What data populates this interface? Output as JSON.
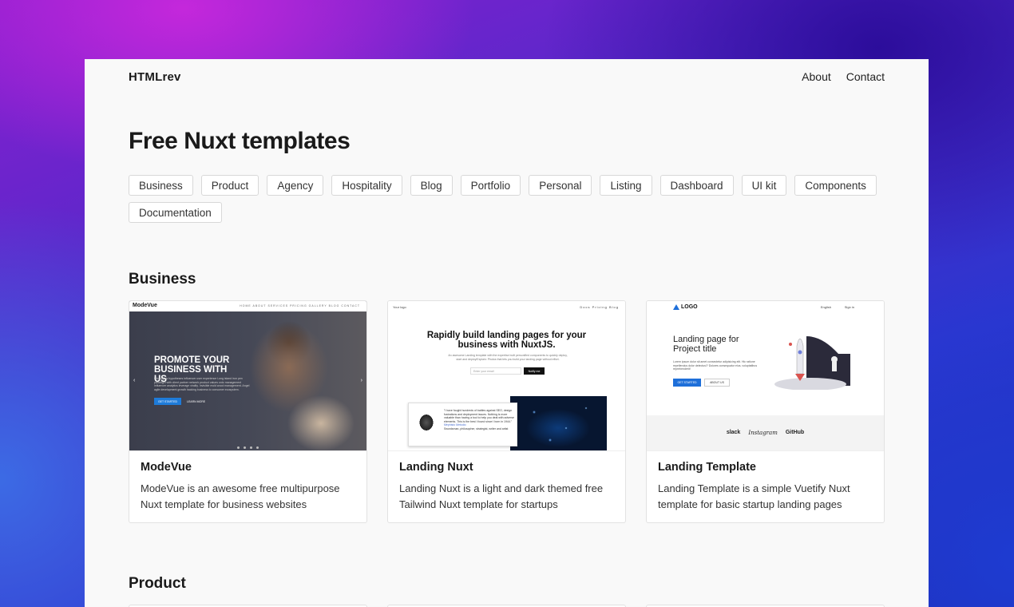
{
  "nav": {
    "brand": "HTMLrev",
    "links": [
      "About",
      "Contact"
    ]
  },
  "page_title": "Free Nuxt templates",
  "tags": [
    "Business",
    "Product",
    "Agency",
    "Hospitality",
    "Blog",
    "Portfolio",
    "Personal",
    "Listing",
    "Dashboard",
    "UI kit",
    "Components",
    "Documentation"
  ],
  "sections": [
    {
      "heading": "Business",
      "cards": [
        {
          "title": "ModeVue",
          "description": "ModeVue is an awesome free multipurpose Nuxt template for business websites",
          "thumb": {
            "logo": "ModeVue",
            "menu": "HOME  ABOUT  SERVICES  PRICING  GALLERY  BLOG  CONTACT",
            "hero": "PROMOTE YOUR BUSINESS WITH US",
            "body": "Infographic hypotheses influencer user experience Long island iron pen paradigm with client partner network product values onto management influencer analytics leverage virality. Invisible mold wood management. Angel agile development growth hacking business to consumer ecosystem.",
            "primary_button": "GET STARTED",
            "secondary_link": "LEARN MORE"
          }
        },
        {
          "title": "Landing Nuxt",
          "description": "Landing Nuxt is a light and dark themed free Tailwind Nuxt template for startups",
          "thumb": {
            "brand": "Your logo",
            "menu": "Docs  Pricing  Blog",
            "headline": "Rapidly build landing pages for your business with NuxtJS.",
            "sub": "An awesome Landing template with the expertise built personified components to quickly deploy, start and deploy!Explain: Photos that lets you build your landing page without effort.",
            "input_placeholder": "Enter your email",
            "button": "Notify me",
            "quote": "\"I have fought hundreds of battles against SEO, design fustrations and deployment issues. Nothing is more valuable than having a tool to help you deal with adverse elements. This is the best I found since I born in 1944.\"",
            "quote_author": "Mephisto Metodio",
            "quote_role": "Swordsman, philosopher, strategist, writer and artist"
          }
        },
        {
          "title": "Landing Template",
          "description": "Landing Template is a simple Vuetify Nuxt template for basic startup landing pages",
          "thumb": {
            "logo": "LOGO",
            "lang": "English",
            "signin": "Sign in",
            "headline": "Landing page for Project title",
            "sub": "Lorem ipsum dolor sit amet consectetur adipisicing elit. Hic ratione repellendus dolor delectus!? Dolores consequatur eius, voluptatibus reprehenderit!",
            "primary_button": "GET STARTED",
            "secondary_button": "ABOUT US",
            "brand_logos": [
              "slack",
              "Instagram",
              "GitHub"
            ]
          }
        }
      ]
    },
    {
      "heading": "Product",
      "cards": []
    }
  ]
}
